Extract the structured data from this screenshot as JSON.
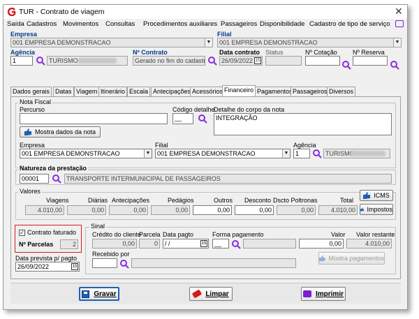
{
  "window": {
    "title": "TUR - Contrato de viagem"
  },
  "menu": [
    "Saída",
    "Cadastros",
    "Movimentos",
    "Consultas",
    "Procedimentos auxiliares",
    "Passageiros",
    "Disponibilidade",
    "Cadastro de tipo de serviço"
  ],
  "header": {
    "empresa_label": "Empresa",
    "empresa_value": "001 EMPRESA DEMONSTRACAO",
    "filial_label": "Filial",
    "filial_value": "001 EMPRESA DEMONSTRACAO",
    "agencia_label": "Agência",
    "agencia_value": "1",
    "agencia_name": "TURISMO",
    "contrato_label": "Nº Contrato",
    "contrato_value": "Gerado no fim do cadastro...",
    "data_contrato_label": "Data contrato",
    "data_contrato_value": "26/09/2022",
    "status_label": "Status",
    "cotacao_label": "Nº Cotação",
    "reserva_label": "Nº Reserva"
  },
  "tabs": [
    "Dados gerais",
    "Datas",
    "Viagem",
    "Itinerário",
    "Escala",
    "Antecipações",
    "Acessórios",
    "Financeiro",
    "Pagamentos",
    "Passageiros",
    "Diversos"
  ],
  "active_tab": "Financeiro",
  "nota_fiscal": {
    "title": "Nota Fiscal",
    "percurso_label": "Percurso",
    "codigo_detalhe_label": "Código detalhe",
    "codigo_detalhe_value": "__",
    "detalhe_corpo_label": "Detalhe do corpo da nota",
    "detalhe_corpo_value": "INTEGRAÇÃO",
    "mostra_dados_btn": "Mostra dados da nota",
    "empresa_label": "Empresa",
    "empresa_value": "001 EMPRESA DEMONSTRACAO",
    "filial_label": "Filial",
    "filial_value": "001 EMPRESA DEMONSTRACAO",
    "agencia_label": "Agência",
    "agencia_value": "1",
    "agencia_name": "TURISMO"
  },
  "natureza": {
    "title": "Natureza da prestação",
    "code": "00001",
    "description": "TRANSPORTE INTERMUNICIPAL DE PASSAGEIROS"
  },
  "valores": {
    "title": "Valores",
    "columns": [
      "Viagens",
      "Diárias",
      "Antecipações",
      "Pedágios",
      "Outros",
      "Desconto",
      "Dscto Poltronas",
      "Total"
    ],
    "values": [
      "4.010,00",
      "0,00",
      "0,00",
      "0,00",
      "0,00",
      "0,00",
      "0,00",
      "4.010,00"
    ],
    "icms_btn": "ICMS",
    "impostos_btn": "Impostos"
  },
  "faturado": {
    "checkbox_label": "Contrato faturado",
    "checked": true,
    "parcelas_label": "Nº Parcelas",
    "parcelas_value": "2"
  },
  "data_prevista": {
    "label": "Data prevista p/ pagto",
    "value": "26/09/2022"
  },
  "sinal": {
    "title": "Sinal",
    "credito_label": "Crédito do cliente",
    "credito_value": "0,00",
    "parcela_label": "Parcela",
    "parcela_value": "0",
    "data_pagto_label": "Data pagto",
    "data_pagto_value": "/ /",
    "forma_label": "Forma pagamento",
    "forma_value": "__",
    "valor_label": "Valor",
    "valor_value": "0,00",
    "valor_restante_label": "Valor restante",
    "valor_restante_value": "4.010,00",
    "recebido_label": "Recebido por",
    "mostra_pagamentos_btn": "Mostra pagamentos"
  },
  "footer": {
    "gravar": "Gravar",
    "limpar": "Limpar",
    "imprimir": "Imprimir"
  },
  "colors": {
    "accent_blue": "#1e5fb4",
    "search_purple": "#8a2be2",
    "highlight_red": "#d41b1b"
  }
}
